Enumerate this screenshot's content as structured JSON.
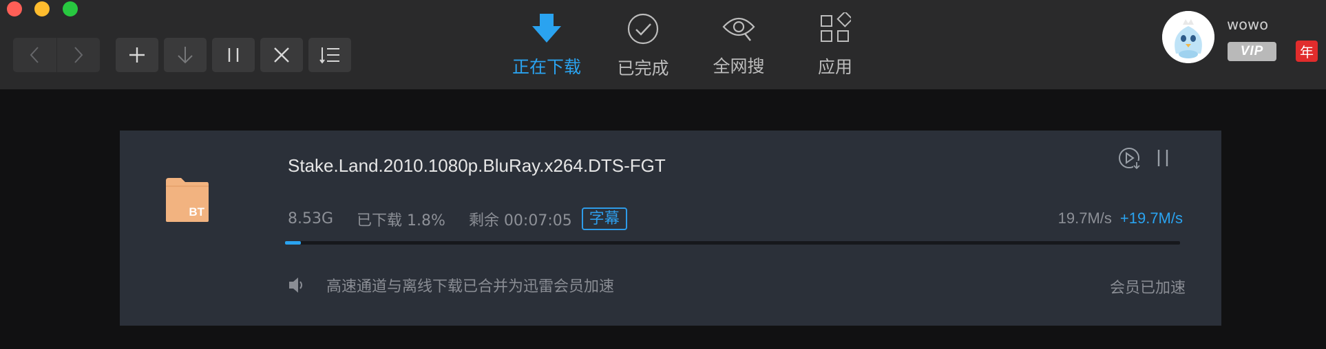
{
  "window": {
    "traffic_lights": [
      "close",
      "minimize",
      "zoom"
    ]
  },
  "toolbar": {
    "back_icon": "chevron-left-icon",
    "forward_icon": "chevron-right-icon",
    "buttons": [
      {
        "name": "add-task-button",
        "icon": "plus-icon"
      },
      {
        "name": "start-download-button",
        "icon": "arrow-down-icon"
      },
      {
        "name": "pause-button",
        "icon": "pause-icon"
      },
      {
        "name": "delete-button",
        "icon": "close-icon"
      },
      {
        "name": "sort-button",
        "icon": "sort-list-icon"
      }
    ]
  },
  "tabs": [
    {
      "label": "正在下载",
      "icon": "download-arrow-icon",
      "active": true
    },
    {
      "label": "已完成",
      "icon": "check-circle-icon",
      "active": false
    },
    {
      "label": "全网搜",
      "icon": "eye-search-icon",
      "active": false
    },
    {
      "label": "应用",
      "icon": "apps-grid-icon",
      "active": false
    }
  ],
  "user": {
    "name": "wowo",
    "vip_label": "VIP",
    "year_badge": "年"
  },
  "task": {
    "file_name": "Stake.Land.2010.1080p.BluRay.x264.DTS-FGT",
    "file_type_badge": "BT",
    "size": "8.53G",
    "downloaded": "已下载 1.8%",
    "progress_fraction": 0.018,
    "remaining": "剩余 00:07:05",
    "subtitle_badge": "字幕",
    "speed": "19.7M/s",
    "boost_speed": "+19.7M/s",
    "notice": "高速通道与离线下载已合并为迅雷会员加速",
    "boost_status": "会员已加速"
  },
  "colors": {
    "accent": "#2aa3f0",
    "toolbar_bg": "#2a2a2b",
    "card_bg": "#2b3039",
    "folder": "#f2b380",
    "year_badge": "#e12c2c"
  }
}
